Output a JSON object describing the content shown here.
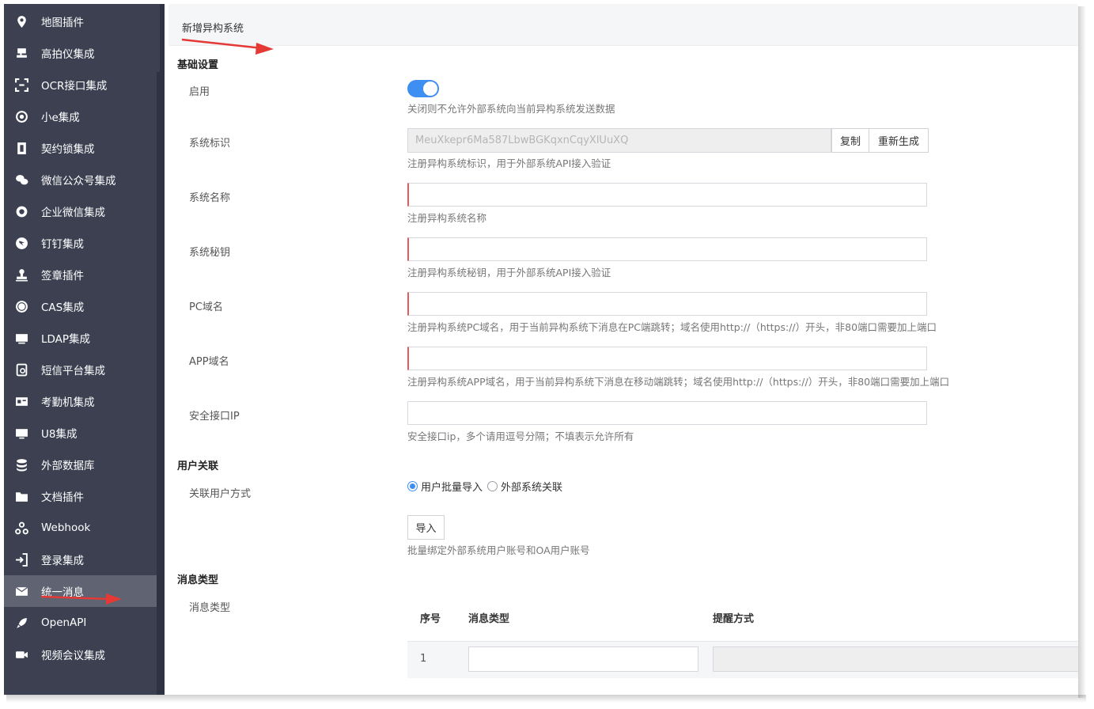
{
  "sidebar": {
    "items": [
      {
        "label": "地图插件",
        "icon": "map-pin-icon"
      },
      {
        "label": "高拍仪集成",
        "icon": "scanner-icon"
      },
      {
        "label": "OCR接口集成",
        "icon": "ocr-icon"
      },
      {
        "label": "小e集成",
        "icon": "bot-icon"
      },
      {
        "label": "契约锁集成",
        "icon": "contract-lock-icon"
      },
      {
        "label": "微信公众号集成",
        "icon": "wechat-icon"
      },
      {
        "label": "企业微信集成",
        "icon": "work-wechat-icon"
      },
      {
        "label": "钉钉集成",
        "icon": "dingtalk-icon"
      },
      {
        "label": "签章插件",
        "icon": "stamp-icon"
      },
      {
        "label": "CAS集成",
        "icon": "cas-icon"
      },
      {
        "label": "LDAP集成",
        "icon": "ldap-icon"
      },
      {
        "label": "短信平台集成",
        "icon": "sms-icon"
      },
      {
        "label": "考勤机集成",
        "icon": "attendance-icon"
      },
      {
        "label": "U8集成",
        "icon": "u8-icon"
      },
      {
        "label": "外部数据库",
        "icon": "database-icon"
      },
      {
        "label": "文档插件",
        "icon": "folder-icon"
      },
      {
        "label": "Webhook",
        "icon": "webhook-icon"
      },
      {
        "label": "登录集成",
        "icon": "login-icon"
      },
      {
        "label": "统一消息",
        "icon": "mail-icon",
        "active": true
      },
      {
        "label": "OpenAPI",
        "icon": "rocket-icon"
      },
      {
        "label": "视频会议集成",
        "icon": "video-icon"
      }
    ]
  },
  "header": {
    "title": "新增异构系统"
  },
  "basic": {
    "section_title": "基础设置",
    "enable_label": "启用",
    "enable_hint": "关闭则不允许外部系统向当前异构系统发送数据",
    "system_id_label": "系统标识",
    "system_id_value": "MeuXkepr6Ma587LbwBGKqxnCqyXlUuXQ",
    "copy_button": "复制",
    "regenerate_button": "重新生成",
    "system_id_hint": "注册异构系统标识，用于外部系统API接入验证",
    "system_name_label": "系统名称",
    "system_name_hint": "注册异构系统名称",
    "secret_label": "系统秘钥",
    "secret_hint": "注册异构系统秘钥，用于外部系统API接入验证",
    "pc_domain_label": "PC域名",
    "pc_domain_hint": "注册异构系统PC域名，用于当前异构系统下消息在PC端跳转；域名使用http://（https://）开头，非80端口需要加上端口",
    "app_domain_label": "APP域名",
    "app_domain_hint": "注册异构系统APP域名，用于当前异构系统下消息在移动端跳转；域名使用http://（https://）开头，非80端口需要加上端口",
    "ip_label": "安全接口IP",
    "ip_hint": "安全接口ip，多个请用逗号分隔；不填表示允许所有"
  },
  "user": {
    "section_title": "用户关联",
    "method_label": "关联用户方式",
    "option1": "用户批量导入",
    "option2": "外部系统关联",
    "import_button": "导入",
    "import_hint": "批量绑定外部系统用户账号和OA用户账号"
  },
  "message": {
    "section_title": "消息类型",
    "field_label": "消息类型",
    "columns": [
      "序号",
      "消息类型",
      "提醒方式"
    ],
    "rows": [
      {
        "index": "1"
      }
    ]
  },
  "colors": {
    "accent": "#3f8ff3",
    "sidebar": "#3c4051",
    "required": "#e85a5a",
    "arrow": "#e53935"
  }
}
